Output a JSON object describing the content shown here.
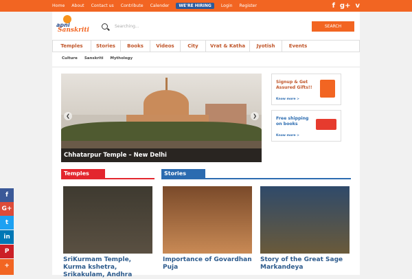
{
  "topnav": {
    "items": [
      "Home",
      "About",
      "Contact us",
      "Contribute",
      "Calender"
    ],
    "hiring": "WE'RE HIRING",
    "auth": [
      "Login",
      "Register"
    ]
  },
  "social": {
    "facebook": "f",
    "gplus": "g+",
    "vine": "v"
  },
  "logo": {
    "line1": "apni",
    "line2": "Sanskriti"
  },
  "search": {
    "placeholder": "Searching...",
    "button": "SEARCH"
  },
  "mainnav": [
    "Temples",
    "Stories",
    "Books",
    "Videos",
    "City",
    "Vrat & Katha",
    "Jyotish",
    "Events"
  ],
  "subnav": [
    "Culture",
    "Sanskriti",
    "Mythology"
  ],
  "slider": {
    "caption": "Chhatarpur Temple – New Delhi",
    "prev": "❮",
    "next": "❯"
  },
  "promos": [
    {
      "title": "Signup & Get Assured Gifts!!",
      "more": "Know more >"
    },
    {
      "title": "Free shipping on books",
      "more": "Know more >"
    }
  ],
  "sections": {
    "temples": "Temples",
    "stories": "Stories"
  },
  "cards": [
    {
      "title": "SriKurmam Temple, Kurma kshetra, Srikakulam, Andhra"
    },
    {
      "title": "Importance of Govardhan Puja"
    },
    {
      "title": "Story of the Great Sage Markandeya"
    }
  ],
  "share": [
    "f",
    "G+",
    "t",
    "in",
    "P",
    "+"
  ],
  "colors": {
    "accent": "#f26522",
    "nav_text": "#c0562a",
    "link": "#2c5a8c",
    "temples": "#e3262e",
    "stories": "#2b6bb0"
  }
}
